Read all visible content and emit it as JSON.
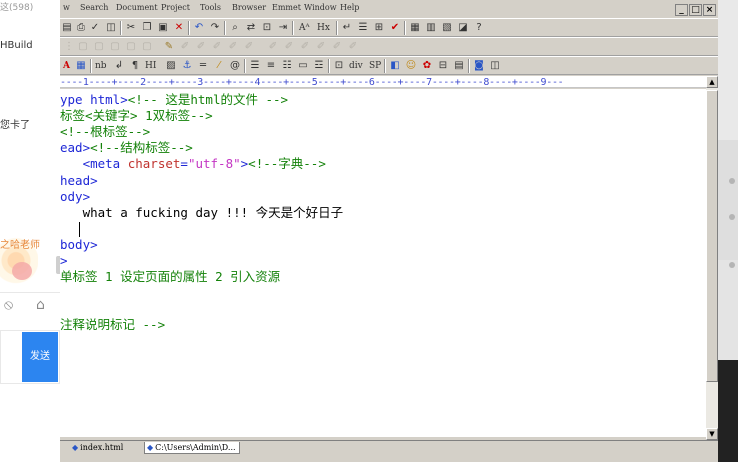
{
  "chat": {
    "title_fragment": "这(598)",
    "name_fragment": "HBuild",
    "message_fragment": "您卡了",
    "teacher_fragment": "之哈老师",
    "send_label": "发送"
  },
  "menu": {
    "items": [
      "w",
      "Search",
      "Document",
      "Project",
      "Tools",
      "Browser",
      "Emmet",
      "Window",
      "Help"
    ],
    "window_controls": [
      "_",
      "□",
      "×"
    ]
  },
  "toolbar3": {
    "nb": "nb",
    "hi": "HI",
    "div": "div",
    "sp": "SP",
    "hx": "Hx"
  },
  "ruler": {
    "text": "----1----+----2----+----3----+----4----+----5----+----6----+----7----+----8----+----9---"
  },
  "editor": {
    "lines": [
      [
        {
          "t": "ype html>",
          "c": "tag"
        },
        {
          "t": "<!-- 这是html的文件 -->",
          "c": "comment"
        }
      ],
      [
        {
          "t": "标签<关键字> 1双标签-->",
          "c": "comment"
        }
      ],
      [
        {
          "t": "<!--根标签-->",
          "c": "comment"
        }
      ],
      [
        {
          "t": "ead>",
          "c": "tag"
        },
        {
          "t": "<!--结构标签-->",
          "c": "comment"
        }
      ],
      [
        {
          "t": "   <meta ",
          "c": "tag"
        },
        {
          "t": "charset",
          "c": "attr"
        },
        {
          "t": "=",
          "c": "tag"
        },
        {
          "t": "\"utf-8\"",
          "c": "str"
        },
        {
          "t": ">",
          "c": "tag"
        },
        {
          "t": "<!--字典-->",
          "c": "comment"
        }
      ],
      [
        {
          "t": "head>",
          "c": "tag"
        }
      ],
      [
        {
          "t": "ody>",
          "c": "tag"
        }
      ],
      [
        {
          "t": "   what a fucking day !!! 今天是个好日子",
          "c": "text"
        }
      ],
      [],
      [
        {
          "t": "body>",
          "c": "tag"
        }
      ],
      [
        {
          "t": ">",
          "c": "tag"
        }
      ],
      [
        {
          "t": "单标签 1 设定页面的属性 2 引入资源",
          "c": "comment"
        }
      ],
      [],
      [],
      [
        {
          "t": "注释说明标记 -->",
          "c": "comment"
        }
      ]
    ]
  },
  "file_tabs": [
    {
      "label": "index.html",
      "active": false
    },
    {
      "label": "C:\\Users\\Admin\\D...",
      "active": true
    }
  ],
  "colors": {
    "tag": "#1f28d6",
    "comment": "#14820a",
    "attribute": "#c0322e",
    "string": "#c436c4",
    "ruler": "#3f4bcf",
    "send_button": "#2c85f0",
    "chrome": "#d4d0c8"
  }
}
